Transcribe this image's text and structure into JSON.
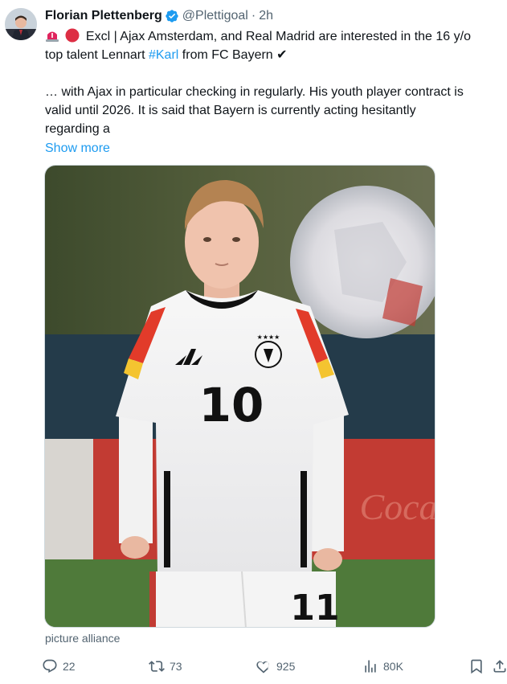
{
  "tweet": {
    "author_name": "Florian Plettenberg",
    "handle": "@Plettigoal",
    "separator": "·",
    "time": "2h",
    "text_line1": "Excl | Ajax Amsterdam, and Real Madrid are interested in the 16 y/o",
    "text_line2_pre": "top talent Lennart ",
    "hashtag": "#Karl",
    "text_line2_post": " from FC Bayern ✔",
    "text_line3": "… with Ajax in particular checking in regularly. His youth player contract is",
    "text_line4": "valid until 2026. It is said that Bayern is currently acting hesitantly",
    "text_line5": "regarding a",
    "show_more": "Show more",
    "media_credit": "picture alliance",
    "jersey_number": "10",
    "shorts_number": "11"
  },
  "actions": {
    "replies": "22",
    "reposts": "73",
    "likes": "925",
    "views": "80K"
  },
  "icons": [
    "verified-badge-icon",
    "siren-icon",
    "red-circle-icon",
    "reply-icon",
    "repost-icon",
    "like-icon",
    "views-icon",
    "bookmark-icon",
    "share-icon"
  ],
  "colors": {
    "accent": "#1d9bf0",
    "secondary_text": "#536471"
  }
}
